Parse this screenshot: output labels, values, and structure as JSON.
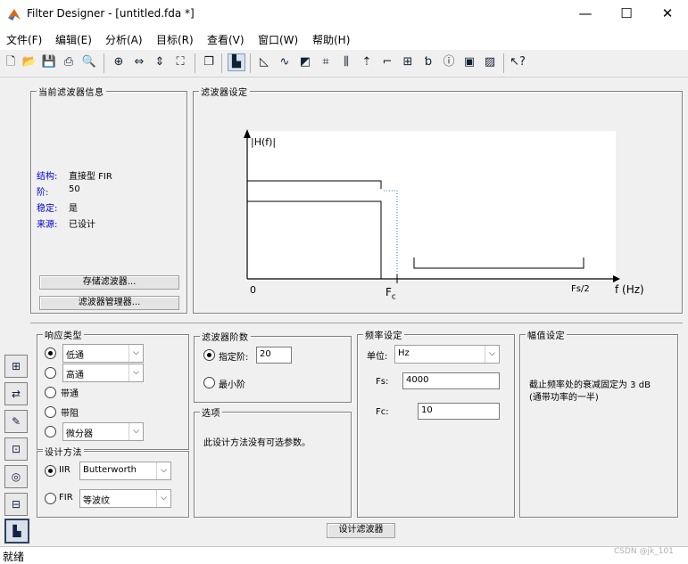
{
  "window": {
    "title": "Filter Designer -  [untitled.fda *]",
    "min": "—",
    "max": "☐",
    "close": "✕"
  },
  "menu": [
    "文件(F)",
    "编辑(E)",
    "分析(A)",
    "目标(R)",
    "查看(V)",
    "窗口(W)",
    "帮助(H)"
  ],
  "toolbar": [
    "new-icon",
    "open-icon",
    "save-icon",
    "print-icon",
    "print-preview-icon",
    "zoom-in-icon",
    "zoom-x-icon",
    "zoom-y-icon",
    "full-view-icon",
    "new-window-icon",
    "filter-specs-icon",
    "magnitude-icon",
    "phase-icon",
    "mag-phase-icon",
    "group-delay-icon",
    "impulse-icon",
    "step-icon",
    "pole-zero-icon",
    "coefficients-icon",
    "info-icon",
    "cost-icon",
    "noise-icon",
    "whats-this-icon"
  ],
  "current_filter": {
    "legend": "当前滤波器信息",
    "rows": [
      {
        "k": "结构:",
        "v": "直接型 FIR"
      },
      {
        "k": "阶:",
        "v": "50"
      },
      {
        "k": "稳定:",
        "v": "是"
      },
      {
        "k": "来源:",
        "v": "已设计"
      }
    ],
    "store_button": "存储滤波器...",
    "manager_button": "滤波器管理器..."
  },
  "filter_specs": {
    "legend": "滤波器设定",
    "ylabel": "|H(f)|",
    "xlabel": "f (Hz)",
    "tick0": "0",
    "fc": "F",
    "fc_sub": "c",
    "fs2": "Fs/2"
  },
  "response_type": {
    "legend": "响应类型",
    "options": [
      {
        "label": "低通",
        "selected": true,
        "dropdown": true
      },
      {
        "label": "高通",
        "selected": false,
        "dropdown": true
      },
      {
        "label": "带通",
        "selected": false,
        "dropdown": false
      },
      {
        "label": "带阻",
        "selected": false,
        "dropdown": false
      },
      {
        "label": "微分器",
        "selected": false,
        "dropdown": true
      }
    ]
  },
  "design_method": {
    "legend": "设计方法",
    "iir_label": "IIR",
    "iir_value": "Butterworth",
    "fir_label": "FIR",
    "fir_value": "等波纹",
    "selected": "IIR"
  },
  "filter_order": {
    "legend": "滤波器阶数",
    "specify_label": "指定阶:",
    "specify_value": "20",
    "minimum_label": "最小阶"
  },
  "options": {
    "legend": "选项",
    "text": "此设计方法没有可选参数。"
  },
  "freq_specs": {
    "legend": "频率设定",
    "units_label": "单位:",
    "units_value": "Hz",
    "fs_label": "Fs:",
    "fs_value": "4000",
    "fc_label": "Fc:",
    "fc_value": "10"
  },
  "mag_specs": {
    "legend": "幅值设定",
    "text1": "截止频率处的衰减固定为 3 dB",
    "text2": "(通带功率的一半)"
  },
  "design_button": "设计滤波器",
  "status": "就绪",
  "watermark": "CSDN @jk_101"
}
